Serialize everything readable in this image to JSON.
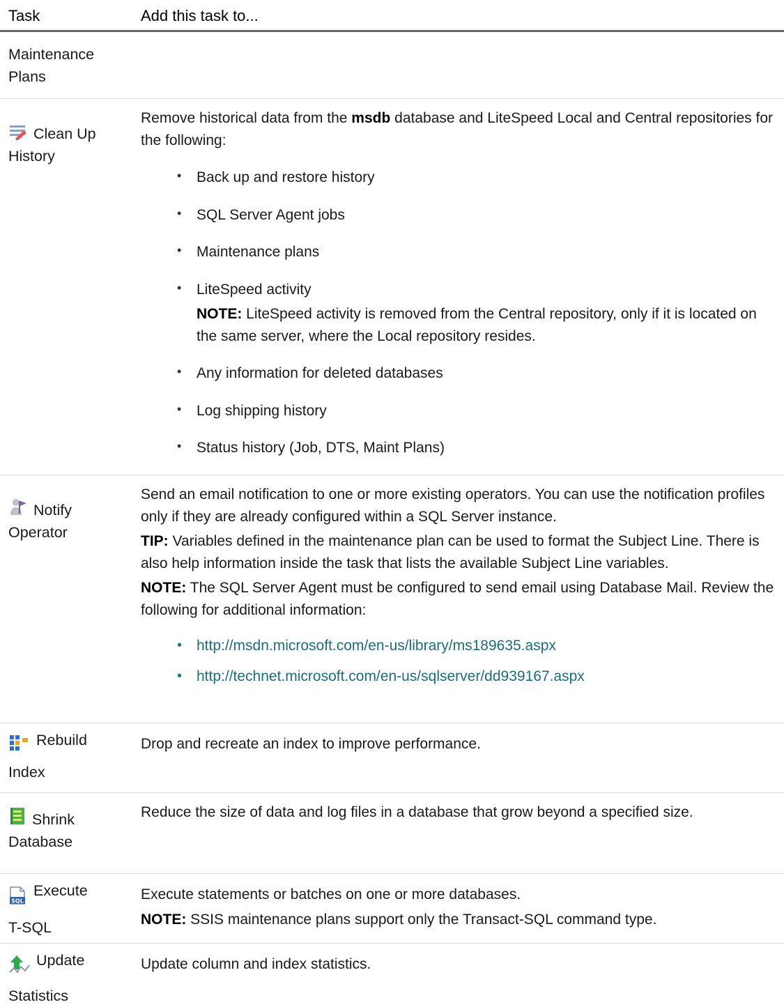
{
  "header": {
    "task": "Task",
    "add": "Add this task to..."
  },
  "section": {
    "label": "Maintenance Plans"
  },
  "cleanup": {
    "title": "Clean Up History",
    "intro_pre": "Remove historical data from the ",
    "intro_bold": "msdb",
    "intro_post": " database and LiteSpeed Local and Central repositories for the following:",
    "items": [
      "Back up and restore history",
      "SQL Server Agent jobs",
      "Maintenance plans",
      "LiteSpeed activity",
      "Any information for deleted databases",
      "Log shipping history",
      "Status history (Job, DTS, Maint Plans)"
    ],
    "note_label": "NOTE:",
    "note_text": " LiteSpeed activity is removed from the Central repository, only if it is located on the same server, where the Local repository resides."
  },
  "notify": {
    "title": "Notify Operator",
    "p1": "Send an email notification to one or more existing operators. You can use the notification profiles only if they are already configured within a SQL Server instance.",
    "tip_label": "TIP:",
    "tip_text": " Variables defined in the maintenance plan can be used to format the Subject Line. There is also help information inside the task that lists the available Subject Line variables.",
    "note_label": "NOTE:",
    "note_text": " The SQL Server Agent must be configured to send email using Database Mail. Review the following for additional information:",
    "links": [
      "http://msdn.microsoft.com/en-us/library/ms189635.aspx",
      "http://technet.microsoft.com/en-us/sqlserver/dd939167.aspx"
    ]
  },
  "rebuild": {
    "title_a": "Rebuild",
    "title_b": "Index",
    "desc": "Drop and recreate an index to improve performance."
  },
  "shrink": {
    "title": "Shrink Database",
    "desc": "Reduce the size of data and log files in a database that grow beyond a specified size."
  },
  "execute": {
    "title_a": "Execute",
    "title_b": "T-SQL",
    "desc": "Execute statements or batches on one or more databases.",
    "note_label": "NOTE:",
    "note_text": " SSIS maintenance plans support only the Transact-SQL command type."
  },
  "update": {
    "title_a": "Update",
    "title_b": "Statistics",
    "desc": "Update column and index statistics."
  },
  "icons": {
    "cleanup": "clean-up-history-icon",
    "notify": "notify-operator-icon",
    "rebuild": "rebuild-index-icon",
    "shrink": "shrink-database-icon",
    "execute": "execute-tsql-icon",
    "update": "update-statistics-icon"
  }
}
